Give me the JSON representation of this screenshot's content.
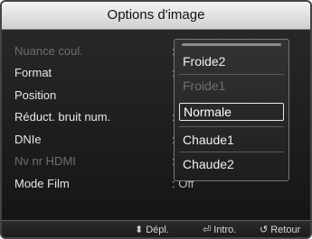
{
  "dialog": {
    "title": "Options d'image"
  },
  "menu": {
    "items": [
      {
        "label": "Nuance coul.",
        "value": ":",
        "enabled": false
      },
      {
        "label": "Format",
        "value": ":",
        "enabled": true
      },
      {
        "label": "Position",
        "value": "",
        "enabled": true
      },
      {
        "label": "Réduct. bruit num.",
        "value": ":",
        "enabled": true
      },
      {
        "label": "DNIe",
        "value": ":",
        "enabled": true
      },
      {
        "label": "Nv nr HDMI",
        "value": ":",
        "enabled": false
      },
      {
        "label": "Mode Film",
        "value": ": Off",
        "enabled": true
      }
    ]
  },
  "popup": {
    "options": [
      {
        "label": "Froide2",
        "enabled": true,
        "selected": false
      },
      {
        "label": "Froide1",
        "enabled": false,
        "selected": false
      },
      {
        "label": "Normale",
        "enabled": true,
        "selected": true
      },
      {
        "label": "Chaude1",
        "enabled": true,
        "selected": false
      },
      {
        "label": "Chaude2",
        "enabled": true,
        "selected": false
      }
    ]
  },
  "footer": {
    "move_icon": "up-down-arrow-icon",
    "move_label": "Dépl.",
    "enter_icon": "enter-icon",
    "enter_label": "Intro.",
    "return_icon": "return-icon",
    "return_label": "Retour"
  }
}
